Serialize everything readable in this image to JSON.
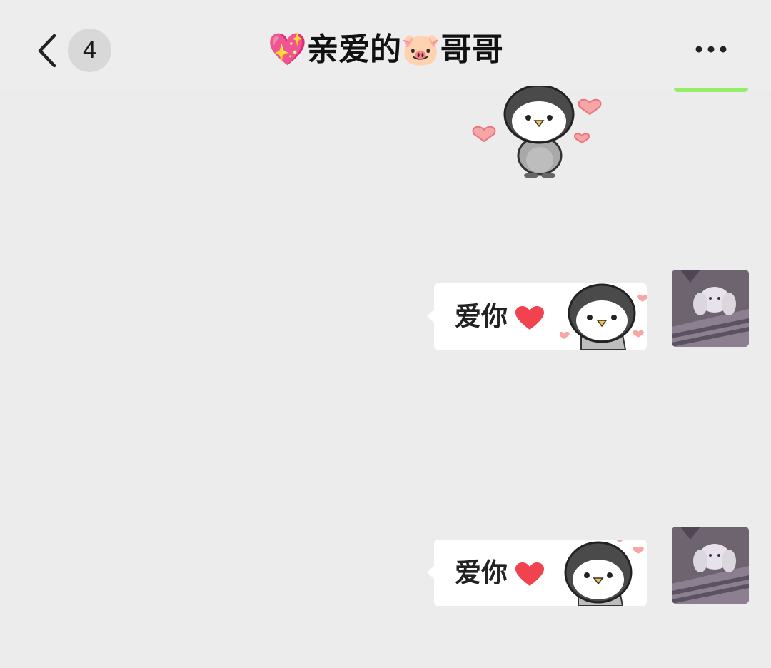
{
  "header": {
    "back_label": "‹",
    "unread_count": "4",
    "title": "💖亲爱的🐷哥哥",
    "more_label": "•••"
  },
  "messages": [
    {
      "type": "sticker",
      "sender": "other",
      "icon": "penguin-hearts-sticker"
    },
    {
      "type": "text",
      "sender": "me",
      "text": "爱你",
      "icon": "red-heart-icon",
      "sticker": "penguin-icon"
    },
    {
      "type": "text",
      "sender": "me",
      "text": "爱你",
      "icon": "red-heart-icon",
      "sticker": "penguin-icon"
    }
  ],
  "colors": {
    "background": "#EDECED",
    "bubble": "#FFFFFF",
    "accent_green": "#95EC69",
    "heart": "#F0424F"
  }
}
